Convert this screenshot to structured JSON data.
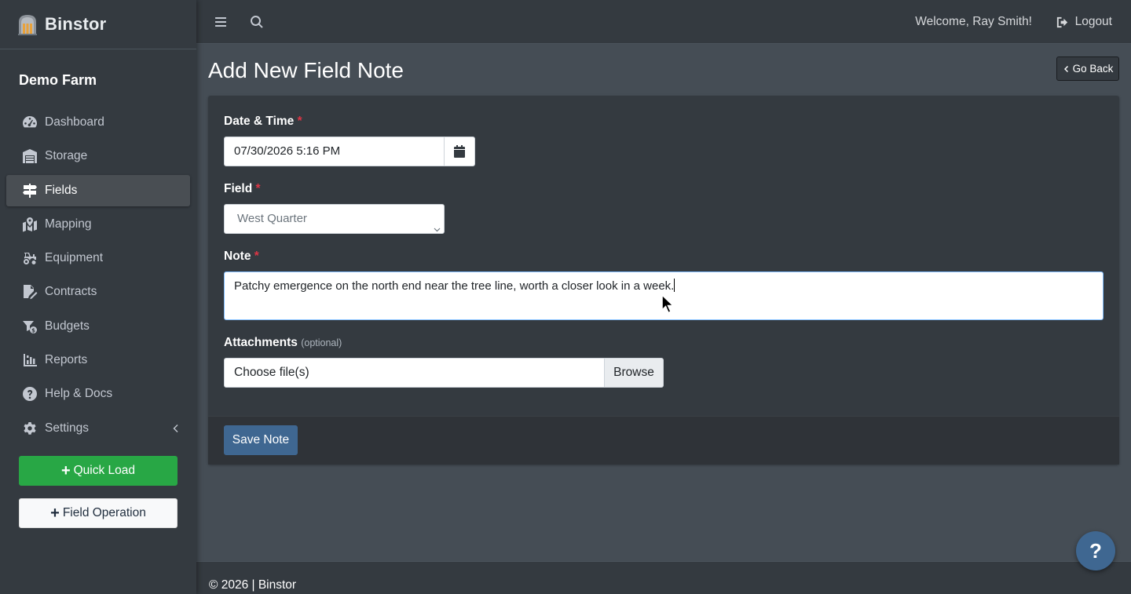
{
  "brand": {
    "name": "Binstor"
  },
  "sidebar": {
    "farm_name": "Demo Farm",
    "items": [
      {
        "label": "Dashboard",
        "icon": "dashboard-icon"
      },
      {
        "label": "Storage",
        "icon": "warehouse-icon"
      },
      {
        "label": "Fields",
        "icon": "signs-icon",
        "active": true
      },
      {
        "label": "Mapping",
        "icon": "map-marked-icon"
      },
      {
        "label": "Equipment",
        "icon": "tractor-icon"
      },
      {
        "label": "Contracts",
        "icon": "file-signature-icon"
      },
      {
        "label": "Budgets",
        "icon": "coins-icon"
      },
      {
        "label": "Reports",
        "icon": "chart-bar-icon"
      },
      {
        "label": "Help & Docs",
        "icon": "question-circle-icon"
      },
      {
        "label": "Settings",
        "icon": "gear-icon"
      }
    ],
    "quick_load_label": "Quick Load",
    "field_operation_label": "Field Operation"
  },
  "topbar": {
    "welcome": "Welcome, Ray Smith!",
    "logout_label": "Logout"
  },
  "page": {
    "title": "Add New Field Note",
    "go_back_label": "Go Back"
  },
  "form": {
    "datetime_label": "Date & Time",
    "datetime_value": "07/30/2026 5:16 PM",
    "field_label": "Field",
    "field_value": "West Quarter",
    "note_label": "Note",
    "note_value": "Patchy emergence on the north end near the tree line, worth a closer look in a week.",
    "attachments_label": "Attachments",
    "attachments_optional": "(optional)",
    "file_placeholder": "Choose file(s)",
    "browse_label": "Browse",
    "required_mark": "*",
    "save_label": "Save Note"
  },
  "footer": {
    "text": "© 2026 | Binstor"
  },
  "help_fab": {
    "label": "?"
  },
  "colors": {
    "sidebar_bg": "#343a40",
    "content_bg": "#454d55",
    "success": "#28a745",
    "primary": "#3f6791",
    "required": "#dc3545"
  }
}
